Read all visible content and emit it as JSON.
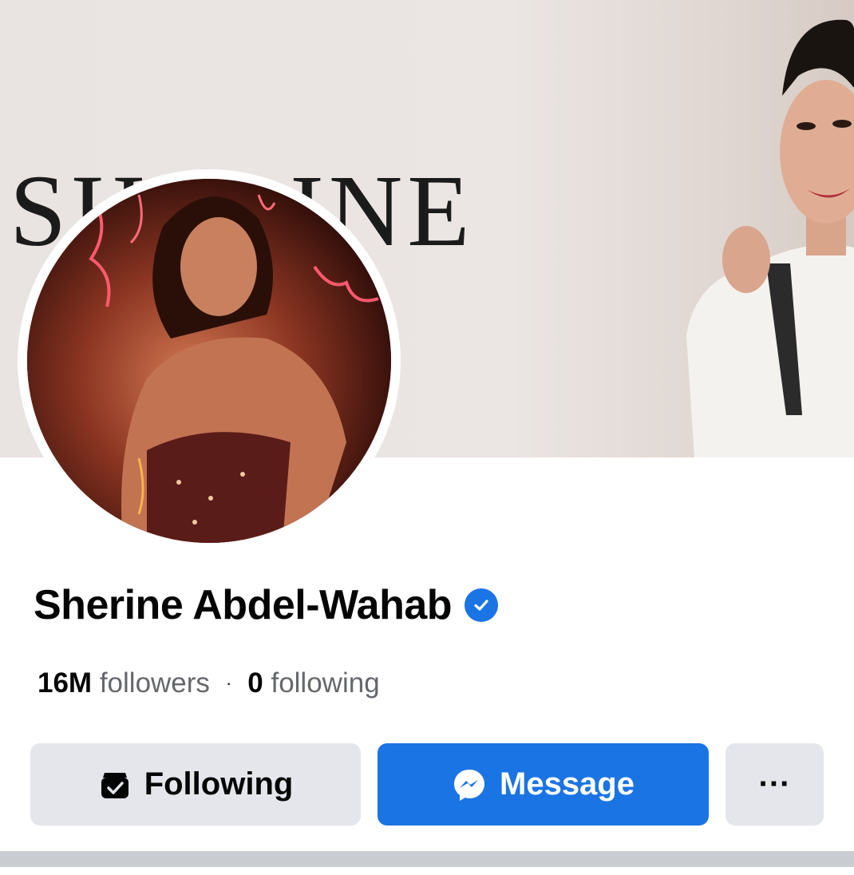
{
  "cover": {
    "wordmark": "SHERINE"
  },
  "profile": {
    "name": "Sherine Abdel-Wahab",
    "verified": true,
    "followers_count": "16M",
    "followers_label": "followers",
    "separator": "·",
    "following_count": "0",
    "following_label": "following"
  },
  "actions": {
    "following_label": "Following",
    "message_label": "Message",
    "more_label": "···"
  },
  "colors": {
    "accent": "#1b74e4",
    "button_gray": "#e4e6eb",
    "text_primary": "#050505",
    "text_secondary": "#65676b"
  }
}
